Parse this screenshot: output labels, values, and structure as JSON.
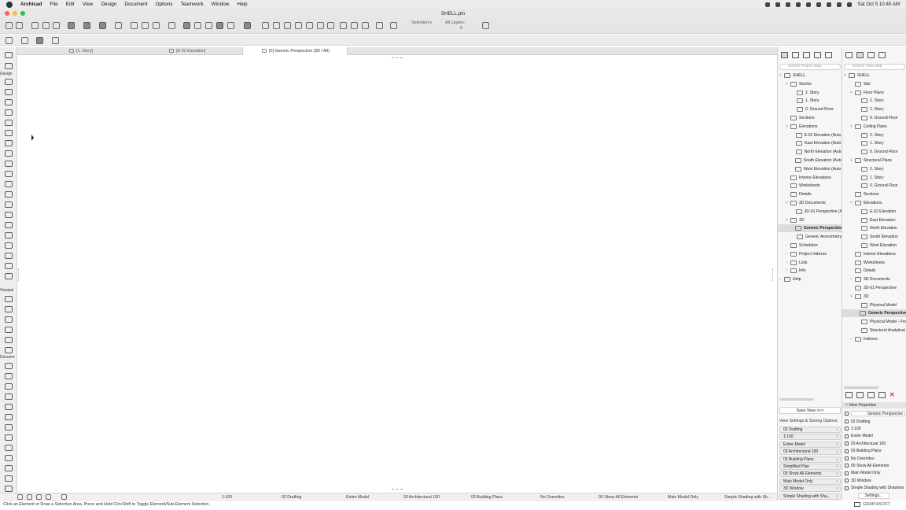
{
  "os_menubar": {
    "app_name": "Archicad",
    "menus": [
      "File",
      "Edit",
      "View",
      "Design",
      "Document",
      "Options",
      "Teamwork",
      "Window",
      "Help"
    ],
    "clock": "Sat Oct 5  10:40 AM"
  },
  "window": {
    "title": "SHELL.pln"
  },
  "toolbar": {
    "selections_label": "Selection's",
    "layers_label": "All Layers:",
    "layers_count": "0"
  },
  "tabs": [
    {
      "label": "[1. Story]"
    },
    {
      "label": "[E-02 Elevation]"
    },
    {
      "label": "[0] Generic Perspective (3D / All)"
    }
  ],
  "toolbox": {
    "sections": [
      "Design",
      "Viewpoi",
      "Docume"
    ]
  },
  "status": {
    "scale": "1:100",
    "layer_combo": "02 Drafting",
    "model_view": "Entire Model",
    "pen_set": "03 Architectural 100",
    "mvo": "03 Building Plans",
    "overrides": "No Overrides",
    "renovation": "00 Show All Elements",
    "structure": "Main Model Only",
    "style": "Simple Shading with Sh...",
    "hint": "Click an Element or Draw a Selection Area. Press and Hold Ctrl+Shift to Toggle Element/Sub-Element Selection."
  },
  "project_map": {
    "search_placeholder": "Search Project Map",
    "items": [
      {
        "label": "SHELL",
        "level": 0,
        "chevron": "v"
      },
      {
        "label": "Stories",
        "level": 1,
        "chevron": "v"
      },
      {
        "label": "2. Story",
        "level": 2,
        "chevron": ""
      },
      {
        "label": "1. Story",
        "level": 2,
        "chevron": ""
      },
      {
        "label": "0. Ground Floor",
        "level": 2,
        "chevron": ""
      },
      {
        "label": "Sections",
        "level": 1,
        "chevron": ""
      },
      {
        "label": "Elevations",
        "level": 1,
        "chevron": "v"
      },
      {
        "label": "E-02 Elevation (Auto-",
        "level": 2,
        "chevron": ""
      },
      {
        "label": "East Elevation (Auto-",
        "level": 2,
        "chevron": ""
      },
      {
        "label": "North Elevation (Auto",
        "level": 2,
        "chevron": ""
      },
      {
        "label": "South Elevation (Auto",
        "level": 2,
        "chevron": ""
      },
      {
        "label": "West Elevation (Auto-",
        "level": 2,
        "chevron": ""
      },
      {
        "label": "Interior Elevations",
        "level": 1,
        "chevron": ""
      },
      {
        "label": "Worksheets",
        "level": 1,
        "chevron": ""
      },
      {
        "label": "Details",
        "level": 1,
        "chevron": ""
      },
      {
        "label": "3D Documents",
        "level": 1,
        "chevron": "v"
      },
      {
        "label": "3D-01 Perspective (A",
        "level": 2,
        "chevron": ""
      },
      {
        "label": "3D",
        "level": 1,
        "chevron": "v"
      },
      {
        "label": "Generic Perspective",
        "level": 2,
        "chevron": "",
        "selected": true
      },
      {
        "label": "Generic Axonometry",
        "level": 2,
        "chevron": ""
      },
      {
        "label": "Schedules",
        "level": 1,
        "chevron": ">"
      },
      {
        "label": "Project Indexes",
        "level": 1,
        "chevron": ">"
      },
      {
        "label": "Lists",
        "level": 1,
        "chevron": ">"
      },
      {
        "label": "Info",
        "level": 1,
        "chevron": ">"
      },
      {
        "label": "Help",
        "level": 0,
        "chevron": ">"
      }
    ]
  },
  "view_map": {
    "search_placeholder": "Search View Map",
    "items": [
      {
        "label": "SHELL",
        "level": 0,
        "chevron": "v"
      },
      {
        "label": "Site",
        "level": 1,
        "chevron": ""
      },
      {
        "label": "Floor Plans",
        "level": 1,
        "chevron": "v"
      },
      {
        "label": "2. Story",
        "level": 2,
        "chevron": ""
      },
      {
        "label": "1. Story",
        "level": 2,
        "chevron": ""
      },
      {
        "label": "0. Ground Floor",
        "level": 2,
        "chevron": ""
      },
      {
        "label": "Ceiling Plans",
        "level": 1,
        "chevron": "v"
      },
      {
        "label": "2. Story",
        "level": 2,
        "chevron": ""
      },
      {
        "label": "1. Story",
        "level": 2,
        "chevron": ""
      },
      {
        "label": "0. Ground Floor",
        "level": 2,
        "chevron": ""
      },
      {
        "label": "Structural Plans",
        "level": 1,
        "chevron": "v"
      },
      {
        "label": "2. Story",
        "level": 2,
        "chevron": ""
      },
      {
        "label": "1. Story",
        "level": 2,
        "chevron": ""
      },
      {
        "label": "0. Ground Floor",
        "level": 2,
        "chevron": ""
      },
      {
        "label": "Sections",
        "level": 1,
        "chevron": ""
      },
      {
        "label": "Elevations",
        "level": 1,
        "chevron": "v"
      },
      {
        "label": "E-02 Elevation",
        "level": 2,
        "chevron": ""
      },
      {
        "label": "East Elevation",
        "level": 2,
        "chevron": ""
      },
      {
        "label": "North Elevation",
        "level": 2,
        "chevron": ""
      },
      {
        "label": "South Elevation",
        "level": 2,
        "chevron": ""
      },
      {
        "label": "West Elevation",
        "level": 2,
        "chevron": ""
      },
      {
        "label": "Interior Elevations",
        "level": 1,
        "chevron": ""
      },
      {
        "label": "Worksheets",
        "level": 1,
        "chevron": ""
      },
      {
        "label": "Details",
        "level": 1,
        "chevron": ""
      },
      {
        "label": "3D Documents",
        "level": 1,
        "chevron": ">"
      },
      {
        "label": "3D-01 Perspective",
        "level": 1,
        "chevron": ""
      },
      {
        "label": "3D",
        "level": 1,
        "chevron": "v"
      },
      {
        "label": "Physical Model",
        "level": 2,
        "chevron": ""
      },
      {
        "label": "Generic Perspective",
        "level": 2,
        "chevron": "",
        "selected": true
      },
      {
        "label": "Physical Model - Fro",
        "level": 2,
        "chevron": ""
      },
      {
        "label": "Structural Analytical",
        "level": 2,
        "chevron": ""
      },
      {
        "label": "Indexes",
        "level": 1,
        "chevron": ">"
      }
    ]
  },
  "view_settings": {
    "save_view_label": "Save View >>>",
    "storing_label": "View Settings & Storing Options:",
    "options": [
      "02 Drafting",
      "1:100",
      "Entire Model",
      "03 Architectural 100",
      "03 Building Plans",
      "Simplified Plan",
      "00 Show All Elements",
      "Main Model Only",
      "3D Window",
      "Simple Shading with Sha..."
    ]
  },
  "view_properties": {
    "header": "View Properties",
    "name_value": "Generic Perspective",
    "rows": [
      "02 Drafting",
      "1:100",
      "Entire Model",
      "03 Architectural 100",
      "03 Building Plans",
      "No Overrides",
      "00 Show All Elements",
      "Main Model Only",
      "3D Window",
      "Simple Shading with Shadows"
    ],
    "settings_button": "Settings...",
    "brand": "GRAPHISOFT"
  },
  "colors": {
    "close": "#ff5f57",
    "minimize": "#febc2e",
    "zoom": "#28c840",
    "delete_red": "#d23a2f",
    "accent_blue": "#3a76c4"
  }
}
